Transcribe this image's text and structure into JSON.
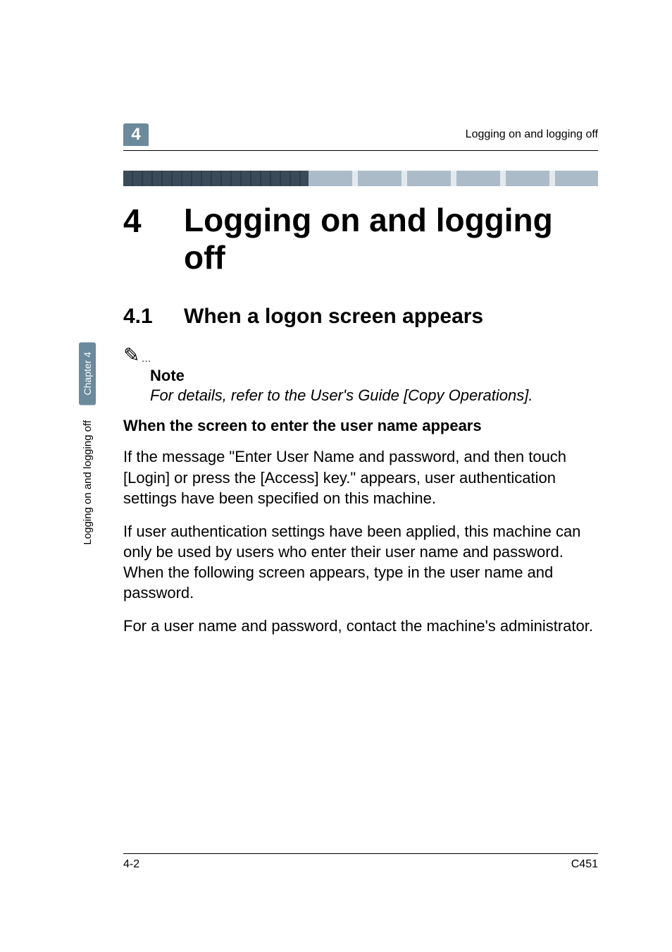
{
  "header": {
    "chapter_number": "4",
    "running_title": "Logging on and logging off"
  },
  "h1": {
    "number": "4",
    "text": "Logging on and logging off"
  },
  "h2": {
    "number": "4.1",
    "text": "When a logon screen appears"
  },
  "note": {
    "icon_glyph": "✎",
    "label": "Note",
    "text": "For details, refer to the User's Guide [Copy Operations]."
  },
  "h3": "When the screen to enter the user name appears",
  "paragraphs": [
    "If the message \"Enter User Name and password, and then touch [Login] or press the [Access] key.\" appears, user authentication settings have been specified on this machine.",
    "If user authentication settings have been applied, this machine can only be used by users who enter their user name and password. When the following screen appears, type in the user name and password.",
    "For a user name and password, contact the machine's administrator."
  ],
  "sidebar": {
    "chapter_label": "Chapter 4",
    "title": "Logging on and logging off"
  },
  "footer": {
    "page": "4-2",
    "model": "C451"
  }
}
